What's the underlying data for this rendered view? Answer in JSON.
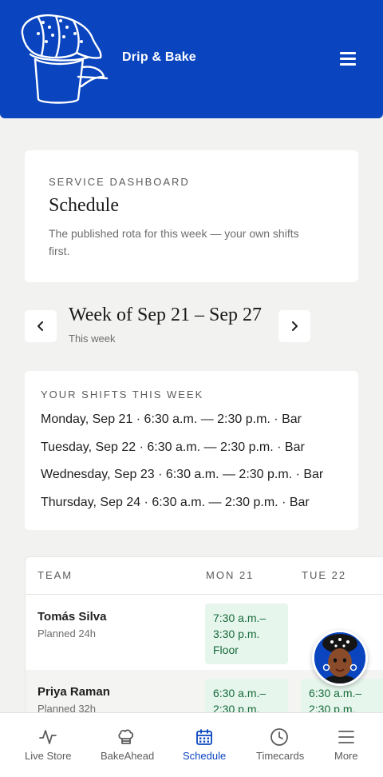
{
  "header": {
    "brand": "Drip & Bake"
  },
  "intro": {
    "eyebrow": "SERVICE DASHBOARD",
    "title": "Schedule",
    "description": "The published rota for this week — your own shifts first."
  },
  "week_nav": {
    "title": "Week of Sep 21 – Sep 27",
    "subtitle": "This week"
  },
  "my_shifts": {
    "eyebrow": "YOUR SHIFTS THIS WEEK",
    "items": [
      "Monday, Sep 21 · 6:30 a.m. — 2:30 p.m. · Bar",
      "Tuesday, Sep 22 · 6:30 a.m. — 2:30 p.m. · Bar",
      "Wednesday, Sep 23 · 6:30 a.m. — 2:30 p.m. · Bar",
      "Thursday, Sep 24 · 6:30 a.m. — 2:30 p.m. · Bar"
    ]
  },
  "table": {
    "headers": [
      "TEAM",
      "MON 21",
      "TUE 22"
    ],
    "rows": [
      {
        "name": "Tomás Silva",
        "planned": "Planned 24h",
        "mon": [
          "7:30 a.m.–",
          "3:30 p.m.",
          "Floor"
        ]
      },
      {
        "name": "Priya Raman",
        "planned": "Planned 32h",
        "mon": [
          "6:30 a.m.–",
          "2:30 p.m."
        ],
        "tue": [
          "6:30 a.m.–",
          "2:30 p.m."
        ]
      }
    ]
  },
  "tabs": [
    {
      "label": "Live Store",
      "icon": "activity-icon"
    },
    {
      "label": "BakeAhead",
      "icon": "chef-hat-icon"
    },
    {
      "label": "Schedule",
      "icon": "calendar-icon",
      "active": true
    },
    {
      "label": "Timecards",
      "icon": "clock-icon"
    },
    {
      "label": "More",
      "icon": "menu-icon"
    }
  ],
  "colors": {
    "brand_blue": "#0a45bf",
    "chip_green_bg": "#e6f6ec",
    "chip_green_text": "#186a3b",
    "background": "#f2f2f0"
  }
}
